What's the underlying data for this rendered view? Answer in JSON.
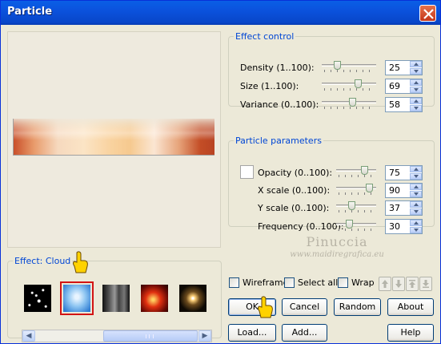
{
  "window": {
    "title": "Particle"
  },
  "effect_control": {
    "legend": "Effect control",
    "rows": [
      {
        "label": "Density (1..100):",
        "value": "25",
        "level": 25
      },
      {
        "label": "Size (1..100):",
        "value": "69",
        "level": 69
      },
      {
        "label": "Variance (0..100):",
        "value": "58",
        "level": 58
      }
    ]
  },
  "particle_parameters": {
    "legend": "Particle parameters",
    "rows": [
      {
        "label": "Opacity (0..100):",
        "value": "75",
        "level": 75
      },
      {
        "label": "X scale (0..100):",
        "value": "90",
        "level": 90
      },
      {
        "label": "Y scale (0..100):",
        "value": "37",
        "level": 37
      },
      {
        "label": "Frequency (0..100):",
        "value": "30",
        "level": 30
      }
    ]
  },
  "effects": {
    "legend": "Effect: Cloud",
    "selected_index": 1,
    "thumbs": [
      "stars-thumbnail",
      "cloud-thumbnail",
      "smoke-thumbnail",
      "fire-thumbnail",
      "flare-thumbnail"
    ]
  },
  "options": {
    "wireframe": "Wireframe",
    "select_all": "Select all",
    "wrap": "Wrap"
  },
  "buttons": {
    "ok": "OK",
    "cancel": "Cancel",
    "random": "Random",
    "about": "About",
    "load": "Load...",
    "add": "Add...",
    "help": "Help"
  },
  "watermark": {
    "line1": "Pinuccia",
    "line2": "www.maidiregrafica.eu"
  }
}
